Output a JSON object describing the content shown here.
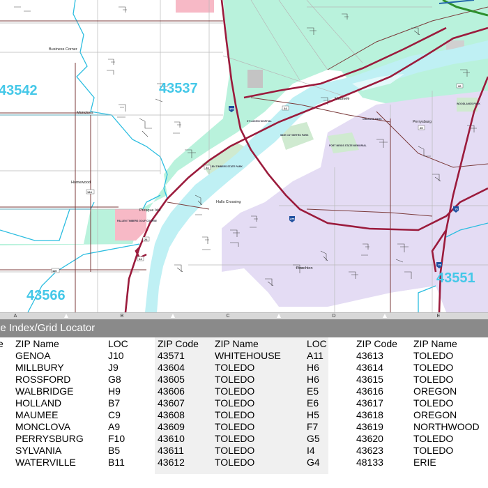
{
  "map": {
    "zip_labels": [
      "43542",
      "43537",
      "43566",
      "43551"
    ],
    "place_labels": {
      "business_corners": "Business Corner",
      "monclova": "Monclova",
      "homewood": "Homewood",
      "presque_isle": "Presque Isle",
      "hulls_crossing": "Hulls Crossing",
      "maumee": "Maumee",
      "perrysburg": "Perrysburg",
      "roachton": "Roachton"
    },
    "route_labels": {
      "i475a": "475",
      "i475b": "475",
      "i75": "75",
      "sr24a": "24",
      "sr24b": "24",
      "sr24c": "24",
      "sr24d": "24",
      "sr25": "25",
      "sr20": "20",
      "sr124": "124",
      "sr110": "110"
    },
    "park_labels": {
      "fallen_timbers": "FALLEN TIMBERS STATE PARK",
      "side_cut": "SIDE CUT METRO PARK",
      "fort_meigs": "FORT MEIGS STATE MEMORIAL",
      "orleans": "ORLEANS PARK",
      "st_lukes": "ST LUKES HOSPITAL",
      "fallen_timbers_golf": "FALLEN TIMBERS GOLF COURSE",
      "woodlands": "WOODLANDS PARK"
    },
    "colors": {
      "zip_43537": "#b9f2dc",
      "zip_43551": "#e4dcf4",
      "zip_43542": "#ffffff",
      "zip_pink": "#f7b9c6",
      "water": "#bff0f4",
      "park": "#cfead0",
      "highway": "#9b1b3c",
      "boundary": "#2bbde0",
      "zip_text": "#45c8e8"
    }
  },
  "ruler": {
    "letters": [
      "A",
      "B",
      "C",
      "D",
      "E"
    ]
  },
  "index": {
    "title": "le Index/Grid Locator",
    "headers": {
      "col1_partial": "e",
      "zip_name_1": "ZIP Name",
      "loc_1": "LOC",
      "zip_code_2": "ZIP Code",
      "zip_name_2": "ZIP Name",
      "loc_2": "LOC",
      "zip_code_3": "ZIP Code",
      "zip_name_3": "ZIP Name"
    },
    "group1": [
      {
        "name": "GENOA",
        "loc": "J10"
      },
      {
        "name": "MILLBURY",
        "loc": "J9"
      },
      {
        "name": "ROSSFORD",
        "loc": "G8"
      },
      {
        "name": "WALBRIDGE",
        "loc": "H9"
      },
      {
        "name": "HOLLAND",
        "loc": "B7"
      },
      {
        "name": "MAUMEE",
        "loc": "C9"
      },
      {
        "name": "MONCLOVA",
        "loc": "A9"
      },
      {
        "name": "PERRYSBURG",
        "loc": "F10"
      },
      {
        "name": "SYLVANIA",
        "loc": "B5"
      },
      {
        "name": "WATERVILLE",
        "loc": "B11"
      }
    ],
    "group2": [
      {
        "code": "43571",
        "name": "WHITEHOUSE",
        "loc": "A11"
      },
      {
        "code": "43604",
        "name": "TOLEDO",
        "loc": "H6"
      },
      {
        "code": "43605",
        "name": "TOLEDO",
        "loc": "H6"
      },
      {
        "code": "43606",
        "name": "TOLEDO",
        "loc": "E5"
      },
      {
        "code": "43607",
        "name": "TOLEDO",
        "loc": "E6"
      },
      {
        "code": "43608",
        "name": "TOLEDO",
        "loc": "H5"
      },
      {
        "code": "43609",
        "name": "TOLEDO",
        "loc": "F7"
      },
      {
        "code": "43610",
        "name": "TOLEDO",
        "loc": "G5"
      },
      {
        "code": "43611",
        "name": "TOLEDO",
        "loc": "I4"
      },
      {
        "code": "43612",
        "name": "TOLEDO",
        "loc": "G4"
      }
    ],
    "group3": [
      {
        "code": "43613",
        "name": "TOLEDO"
      },
      {
        "code": "43614",
        "name": "TOLEDO"
      },
      {
        "code": "43615",
        "name": "TOLEDO"
      },
      {
        "code": "43616",
        "name": "OREGON"
      },
      {
        "code": "43617",
        "name": "TOLEDO"
      },
      {
        "code": "43618",
        "name": "OREGON"
      },
      {
        "code": "43619",
        "name": "NORTHWOOD"
      },
      {
        "code": "43620",
        "name": "TOLEDO"
      },
      {
        "code": "43623",
        "name": "TOLEDO"
      },
      {
        "code": "48133",
        "name": "ERIE"
      }
    ]
  }
}
